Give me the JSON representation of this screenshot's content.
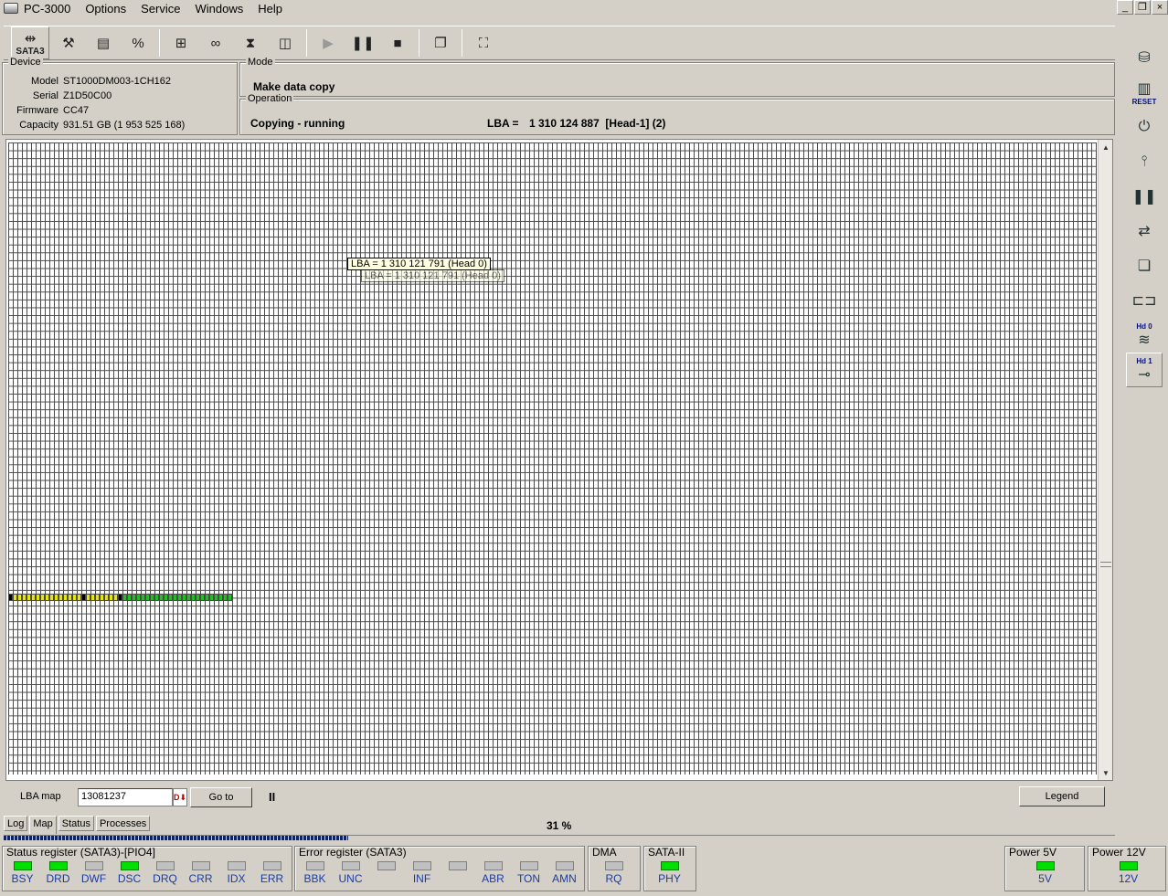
{
  "app": {
    "title": "PC-3000"
  },
  "menu": [
    "Options",
    "Service",
    "Windows",
    "Help"
  ],
  "window_controls": {
    "minimize": "_",
    "restore": "❐",
    "close": "×"
  },
  "toolbar": {
    "sata_label": "SATA3"
  },
  "device": {
    "title": "Device",
    "model_label": "Model",
    "model": "ST1000DM003-1CH162",
    "serial_label": "Serial",
    "serial": "Z1D50C00",
    "firmware_label": "Firmware",
    "firmware": "CC47",
    "capacity_label": "Capacity",
    "capacity": "931.51 GB (1 953 525 168)"
  },
  "mode": {
    "title": "Mode",
    "value": "Make data copy"
  },
  "operation": {
    "title": "Operation",
    "status": "Copying - running",
    "lba_label": "LBA =",
    "lba_value": "1 310 124 887  [Head-1] (2)"
  },
  "map": {
    "tooltip": "LBA = 1 310 121 791 (Head 0)",
    "colors": {
      "empty": "#ffffff",
      "yellow": "#e8e800",
      "black": "#000000",
      "green": "#20c020"
    },
    "highlight_row": [
      "black",
      "yellow",
      "yellow",
      "yellow",
      "yellow",
      "yellow",
      "yellow",
      "yellow",
      "yellow",
      "yellow",
      "yellow",
      "yellow",
      "yellow",
      "yellow",
      "yellow",
      "yellow",
      "black",
      "yellow",
      "yellow",
      "yellow",
      "yellow",
      "yellow",
      "yellow",
      "yellow",
      "black",
      "green",
      "green",
      "green",
      "green",
      "green",
      "green",
      "green",
      "green",
      "green",
      "green",
      "green",
      "green",
      "green",
      "green",
      "green",
      "green",
      "green",
      "green",
      "green",
      "green",
      "green",
      "green",
      "green",
      "green"
    ]
  },
  "lba_map": {
    "label": "LBA map",
    "value": "13081237",
    "goto_label": "Go to",
    "legend_label": "Legend",
    "pause_glyph": "II"
  },
  "tabs": [
    "Log",
    "Map",
    "Status",
    "Processes"
  ],
  "progress": {
    "text": "31 %",
    "value": 0.31
  },
  "status_register": {
    "title": "Status register (SATA3)-[PIO4]",
    "bits": [
      {
        "label": "BSY",
        "on": true
      },
      {
        "label": "DRD",
        "on": true
      },
      {
        "label": "DWF",
        "on": false
      },
      {
        "label": "DSC",
        "on": true
      },
      {
        "label": "DRQ",
        "on": false
      },
      {
        "label": "CRR",
        "on": false
      },
      {
        "label": "IDX",
        "on": false
      },
      {
        "label": "ERR",
        "on": false
      }
    ]
  },
  "error_register": {
    "title": "Error register (SATA3)",
    "bits": [
      {
        "label": "BBK",
        "on": false
      },
      {
        "label": "UNC",
        "on": false
      },
      {
        "label": "",
        "on": false
      },
      {
        "label": "INF",
        "on": false
      },
      {
        "label": "",
        "on": false
      },
      {
        "label": "ABR",
        "on": false
      },
      {
        "label": "TON",
        "on": false
      },
      {
        "label": "AMN",
        "on": false
      }
    ]
  },
  "dma": {
    "title": "DMA",
    "bits": [
      {
        "label": "RQ",
        "on": false
      }
    ]
  },
  "sata2": {
    "title": "SATA-II",
    "bits": [
      {
        "label": "PHY",
        "on": true
      }
    ]
  },
  "power5": {
    "title": "Power 5V",
    "bits": [
      {
        "label": "5V",
        "on": true
      }
    ]
  },
  "power12": {
    "title": "Power 12V",
    "bits": [
      {
        "label": "12V",
        "on": true
      }
    ]
  },
  "right_toolbar": {
    "reset_label": "RESET",
    "hd0_label": "Hd 0",
    "hd1_label": "Hd 1"
  }
}
